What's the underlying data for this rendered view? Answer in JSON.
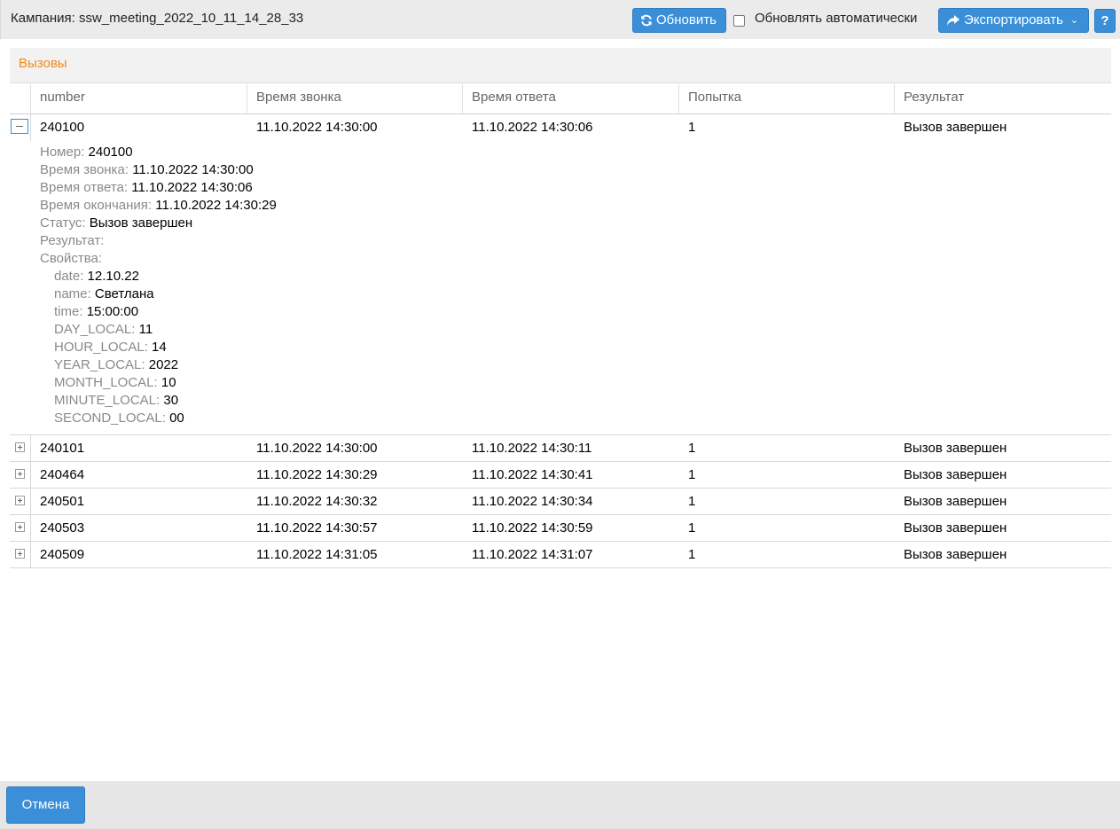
{
  "header": {
    "title": "Кампания: ssw_meeting_2022_10_11_14_28_33",
    "refresh_label": "Обновить",
    "auto_refresh_label": "Обновлять автоматически",
    "auto_refresh_checked": false,
    "export_label": "Экспортировать",
    "help_label": "?"
  },
  "section": {
    "title": "Вызовы"
  },
  "table": {
    "columns": [
      "number",
      "Время звонка",
      "Время ответа",
      "Попытка",
      "Результат"
    ],
    "rows": [
      [
        "240100",
        "11.10.2022 14:30:00",
        "11.10.2022 14:30:06",
        "1",
        "Вызов завершен"
      ],
      [
        "240101",
        "11.10.2022 14:30:00",
        "11.10.2022 14:30:11",
        "1",
        "Вызов завершен"
      ],
      [
        "240464",
        "11.10.2022 14:30:29",
        "11.10.2022 14:30:41",
        "1",
        "Вызов завершен"
      ],
      [
        "240501",
        "11.10.2022 14:30:32",
        "11.10.2022 14:30:34",
        "1",
        "Вызов завершен"
      ],
      [
        "240503",
        "11.10.2022 14:30:57",
        "11.10.2022 14:30:59",
        "1",
        "Вызов завершен"
      ],
      [
        "240509",
        "11.10.2022 14:31:05",
        "11.10.2022 14:31:07",
        "1",
        "Вызов завершен"
      ]
    ]
  },
  "details": {
    "fields": [
      {
        "k": "Номер",
        "v": "240100"
      },
      {
        "k": "Время звонка",
        "v": "11.10.2022 14:30:00"
      },
      {
        "k": "Время ответа",
        "v": "11.10.2022 14:30:06"
      },
      {
        "k": "Время окончания",
        "v": "11.10.2022 14:30:29"
      },
      {
        "k": "Статус",
        "v": "Вызов завершен"
      },
      {
        "k": "Результат",
        "v": ""
      },
      {
        "k": "Свойства",
        "v": ""
      }
    ],
    "properties": [
      {
        "k": "date",
        "v": "12.10.22"
      },
      {
        "k": "name",
        "v": "Светлана"
      },
      {
        "k": "time",
        "v": "15:00:00"
      },
      {
        "k": "DAY_LOCAL",
        "v": "11"
      },
      {
        "k": "HOUR_LOCAL",
        "v": "14"
      },
      {
        "k": "YEAR_LOCAL",
        "v": "2022"
      },
      {
        "k": "MONTH_LOCAL",
        "v": "10"
      },
      {
        "k": "MINUTE_LOCAL",
        "v": "30"
      },
      {
        "k": "SECOND_LOCAL",
        "v": "00"
      }
    ]
  },
  "footer": {
    "cancel_label": "Отмена"
  },
  "colors": {
    "accent": "#3a8fd8",
    "section_title": "#f08a1c",
    "label": "#8a8a8a"
  }
}
